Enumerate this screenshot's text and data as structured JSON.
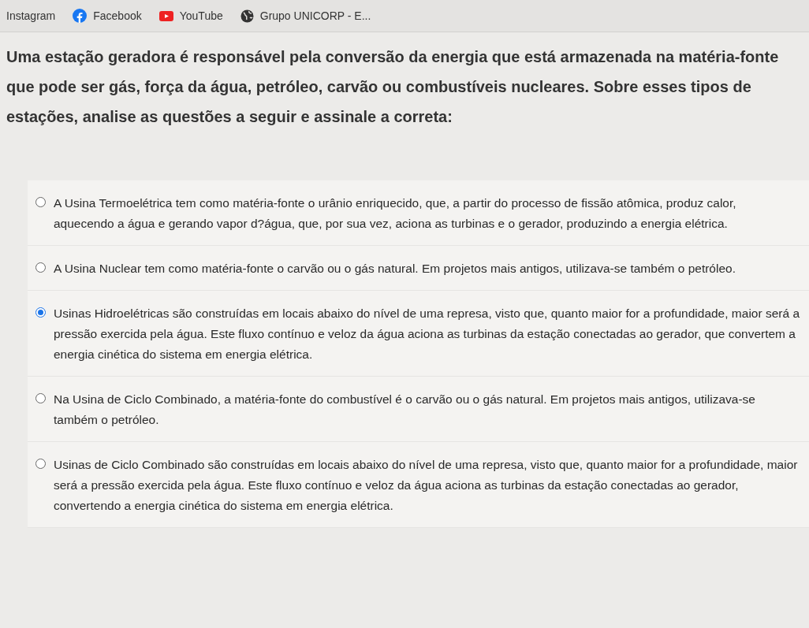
{
  "bookmarks": [
    {
      "label": "Instagram",
      "kind": "none"
    },
    {
      "label": "Facebook",
      "kind": "facebook"
    },
    {
      "label": "YouTube",
      "kind": "youtube"
    },
    {
      "label": "Grupo UNICORP - E...",
      "kind": "globe"
    }
  ],
  "question": "Uma estação geradora é responsável pela conversão da energia que está armazenada na matéria-fonte que pode ser gás, força da água, petróleo, carvão ou combustíveis nucleares. Sobre esses tipos de estações, analise as questões a seguir e assinale a correta:",
  "options": [
    {
      "text": "A Usina Termoelétrica tem como matéria-fonte o urânio enriquecido, que, a partir do processo de fissão atômica, produz calor, aquecendo a água e gerando vapor d?água, que, por sua vez, aciona as turbinas e o gerador, produzindo a energia elétrica.",
      "selected": false
    },
    {
      "text": "A Usina Nuclear tem como matéria-fonte o carvão ou o gás natural. Em projetos mais antigos, utilizava-se também o petróleo.",
      "selected": false
    },
    {
      "text": "Usinas Hidroelétricas são construídas em locais abaixo do nível de uma represa, visto que, quanto maior for a profundidade, maior será a pressão exercida pela água. Este fluxo contínuo e veloz da água aciona as turbinas da estação conectadas ao gerador, que convertem a energia cinética do sistema em energia elétrica.",
      "selected": true
    },
    {
      "text": "Na Usina de Ciclo Combinado, a matéria-fonte do combustível é o carvão ou o gás natural. Em projetos mais antigos, utilizava-se também o petróleo.",
      "selected": false
    },
    {
      "text": "Usinas de Ciclo Combinado são construídas em locais abaixo do nível de uma represa, visto que, quanto maior for a profundidade, maior será a pressão exercida pela água. Este fluxo contínuo e veloz da água aciona as turbinas da estação conectadas ao gerador, convertendo a energia cinética do sistema em energia elétrica.",
      "selected": false
    }
  ]
}
